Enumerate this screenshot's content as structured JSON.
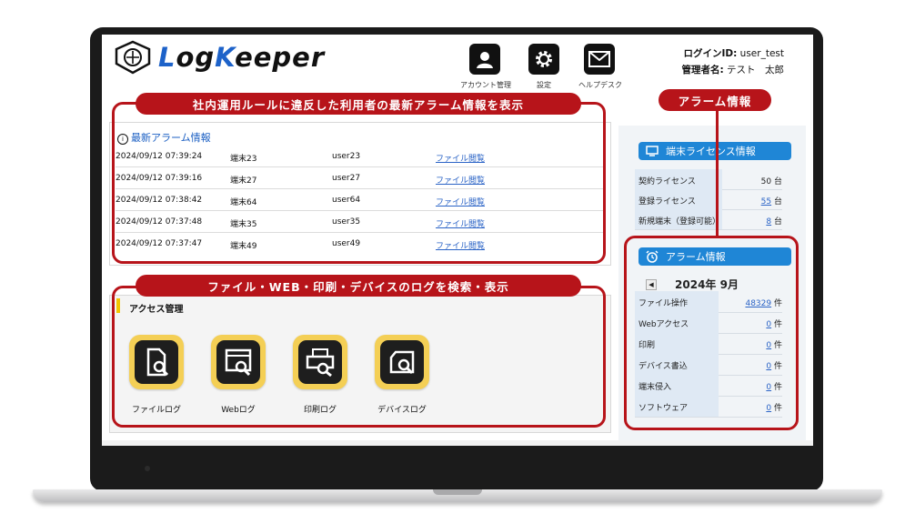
{
  "header": {
    "logo_accent_1": "L",
    "logo_text_1": "og",
    "logo_accent_2": "K",
    "logo_text_2": "eeper",
    "nav": [
      {
        "label": "アカウント管理",
        "icon": "account-icon"
      },
      {
        "label": "設定",
        "icon": "gear-icon"
      },
      {
        "label": "ヘルプデスク",
        "icon": "mail-icon"
      }
    ],
    "login_id_label": "ログインID:",
    "login_id": "user_test",
    "admin_label": "管理者名:",
    "admin_name": "テスト　太郎"
  },
  "callouts": {
    "alarm_latest": "社内運用ルールに違反した利用者の最新アラーム情報を表示",
    "log_search": "ファイル・WEB・印刷・デバイスのログを検索・表示",
    "alarm_info": "アラーム情報"
  },
  "alarm_list": {
    "title": "最新アラーム情報",
    "rows": [
      {
        "date": "2024/09/12 07:39:24",
        "terminal": "端末23",
        "user": "user23",
        "link": "ファイル閲覧"
      },
      {
        "date": "2024/09/12 07:39:16",
        "terminal": "端末27",
        "user": "user27",
        "link": "ファイル閲覧"
      },
      {
        "date": "2024/09/12 07:38:42",
        "terminal": "端末64",
        "user": "user64",
        "link": "ファイル閲覧"
      },
      {
        "date": "2024/09/12 07:37:48",
        "terminal": "端末35",
        "user": "user35",
        "link": "ファイル閲覧"
      },
      {
        "date": "2024/09/12 07:37:47",
        "terminal": "端末49",
        "user": "user49",
        "link": "ファイル閲覧"
      }
    ]
  },
  "access": {
    "title": "アクセス管理",
    "tiles": [
      {
        "label": "ファイルログ",
        "icon": "file-log-icon"
      },
      {
        "label": "Webログ",
        "icon": "web-log-icon"
      },
      {
        "label": "印刷ログ",
        "icon": "print-log-icon"
      },
      {
        "label": "デバイスログ",
        "icon": "device-log-icon"
      }
    ]
  },
  "license": {
    "title": "端末ライセンス情報",
    "rows": [
      {
        "label": "契約ライセンス",
        "value": "50",
        "unit": "台",
        "linked": false
      },
      {
        "label": "登録ライセンス",
        "value": "55",
        "unit": "台",
        "linked": true
      },
      {
        "label": "新規端末（登録可能）",
        "value": "8",
        "unit": "台",
        "linked": true
      }
    ]
  },
  "alarm_info": {
    "title": "アラーム情報",
    "month": "2024年 9月",
    "prev": "◀",
    "rows": [
      {
        "label": "ファイル操作",
        "value": "48329",
        "unit": "件"
      },
      {
        "label": "Webアクセス",
        "value": "0",
        "unit": "件"
      },
      {
        "label": "印刷",
        "value": "0",
        "unit": "件"
      },
      {
        "label": "デバイス書込",
        "value": "0",
        "unit": "件"
      },
      {
        "label": "端末侵入",
        "value": "0",
        "unit": "件"
      },
      {
        "label": "ソフトウェア",
        "value": "0",
        "unit": "件"
      }
    ]
  },
  "colors": {
    "callout": "#b7141a",
    "accent_blue": "#1f86d6",
    "tile_yellow": "#f4cf55"
  }
}
